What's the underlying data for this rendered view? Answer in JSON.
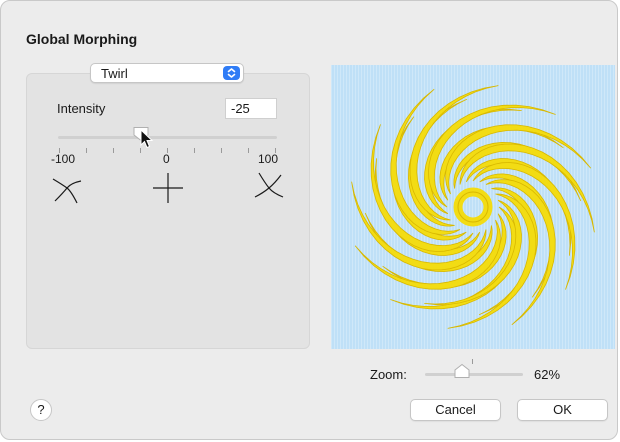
{
  "dialog": {
    "title": "Global Morphing"
  },
  "effect": {
    "selected": "Twirl"
  },
  "intensity": {
    "label": "Intensity",
    "value": "-25",
    "slider": {
      "min": -100,
      "max": 100,
      "value": -25
    },
    "ticks": [
      "-100",
      "0",
      "100"
    ]
  },
  "preview": {
    "background_color": "#bfe0f7",
    "design_color": "#f2dc14"
  },
  "zoom": {
    "label": "Zoom:",
    "value": "62%",
    "level_fraction": 0.4
  },
  "buttons": {
    "help": "?",
    "cancel": "Cancel",
    "ok": "OK"
  },
  "icons": {
    "popup": "up-down-chevron-icon",
    "negative": "twirl-left-icon",
    "neutral": "cross-icon",
    "positive": "twirl-right-icon",
    "cursor": "arrow-cursor-icon"
  }
}
